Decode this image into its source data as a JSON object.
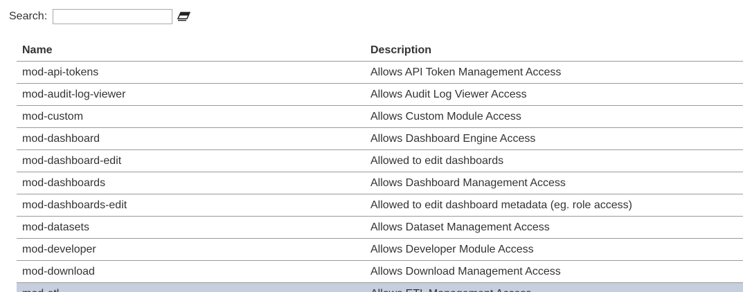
{
  "search": {
    "label": "Search:",
    "value": "",
    "placeholder": "",
    "clear_icon": "eraser-icon"
  },
  "table": {
    "headers": {
      "name": "Name",
      "description": "Description"
    },
    "rows": [
      {
        "name": "mod-api-tokens",
        "description": "Allows API Token Management Access"
      },
      {
        "name": "mod-audit-log-viewer",
        "description": "Allows Audit Log Viewer Access"
      },
      {
        "name": "mod-custom",
        "description": "Allows Custom Module Access"
      },
      {
        "name": "mod-dashboard",
        "description": "Allows Dashboard Engine Access"
      },
      {
        "name": "mod-dashboard-edit",
        "description": "Allowed to edit dashboards"
      },
      {
        "name": "mod-dashboards",
        "description": "Allows Dashboard Management Access"
      },
      {
        "name": "mod-dashboards-edit",
        "description": "Allowed to edit dashboard metadata (eg. role access)"
      },
      {
        "name": "mod-datasets",
        "description": "Allows Dataset Management Access"
      },
      {
        "name": "mod-developer",
        "description": "Allows Developer Module Access"
      },
      {
        "name": "mod-download",
        "description": "Allows Download Management Access"
      },
      {
        "name": "mod-etl",
        "description": "Allows ETL Management Access",
        "selected": true
      }
    ]
  },
  "colors": {
    "selected_row": "#c5cfde",
    "border": "#999999",
    "text": "#333333"
  }
}
